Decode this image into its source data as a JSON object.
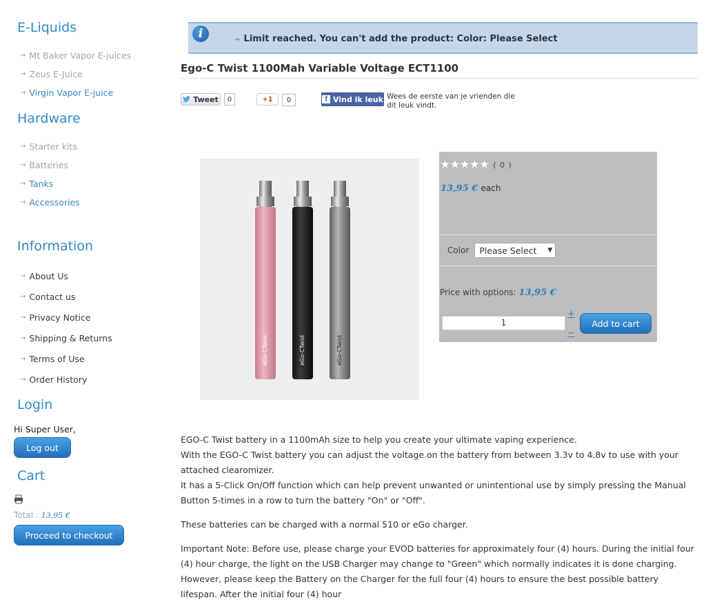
{
  "sidebar": {
    "eliquids": {
      "title": "E-Liquids",
      "items": [
        "Mt Baker Vapor E-juices",
        "Zeus E-Juice",
        "Virgin Vapor E-juice"
      ]
    },
    "hardware": {
      "title": "Hardware",
      "items": [
        "Starter kits",
        "Batteries",
        "Tanks",
        "Accessories"
      ]
    },
    "information": {
      "title": "Information",
      "items": [
        "About Us",
        "Contact us",
        "Privacy Notice",
        "Shipping & Returns",
        "Terms of Use",
        "Order History"
      ]
    },
    "login": {
      "title": "Login",
      "greeting": "Hi Super User,",
      "logout_label": "Log out"
    },
    "cart": {
      "title": "Cart",
      "total_label": "Total :",
      "total_value": "13,95 €",
      "checkout_label": "Proceed to checkout"
    }
  },
  "notice": {
    "message": "Limit reached. You can't add the product: Color: Please Select"
  },
  "product": {
    "title": "Ego-C Twist 1100Mah Variable Voltage ECT1100",
    "rating_count": "( 0 )",
    "price": "13,95 €",
    "price_suffix": "each",
    "color_label": "Color",
    "color_selected": "Please Select",
    "price_with_options_label": "Price with options:",
    "price_with_options": "13,95 €",
    "quantity": "1",
    "qty_plus": "+",
    "qty_minus": "−",
    "add_to_cart": "Add to cart",
    "battery_labels": [
      "eGo-CTwist",
      "eGo-CTwist",
      "eGo-CTwist"
    ],
    "battery_colors": [
      "#e7a4b2",
      "#1c1c1c",
      "#8f8f8f"
    ]
  },
  "social": {
    "tweet_label": "Tweet",
    "tweet_count": "0",
    "gplus_label": "+1",
    "gplus_count": "0",
    "fb_label": "Vind ik leuk",
    "fb_text": "Wees de eerste van je vrienden die dit leuk vindt."
  },
  "description": {
    "p1": "EGO-C Twist battery in a 1100mAh size to help you create your ultimate vaping experience.",
    "p1b": "With the EGO-C Twist battery you can adjust the voltage on the battery from between 3.3v to 4.8v to use with your attached clearomizer.",
    "p1c": "It has a 5-Click On/Off function  which can help prevent unwanted or unintentional use by simply pressing the Manual Button 5-times in a row to turn the battery \"On\" or \"Off\".",
    "p2": "These batteries can be charged with a normal 510 or eGo charger.",
    "p3": "Important Note:  Before use, please charge your EVOD batteries for approximately four (4) hours.  During the initial four (4) hour charge, the light on the USB Charger may change to \"Green\" which normally indicates it is done charging.  However, please keep the Battery on the Charger for the full four (4) hours to ensure the best possible battery lifespan.  After the initial four (4) hour"
  },
  "colors": {
    "accent": "#2f8ac4",
    "notice_bg": "#c5d6ea",
    "buybox_bg": "#bdbdbf",
    "button": "#2a7cc7"
  }
}
